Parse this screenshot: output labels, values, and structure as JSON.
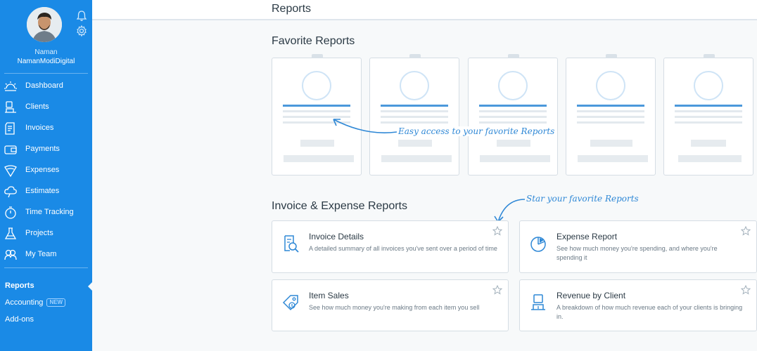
{
  "sidebar": {
    "user_name": "Naman",
    "user_company": "NamanModiDigital",
    "items": [
      {
        "label": "Dashboard",
        "icon": "sun-icon"
      },
      {
        "label": "Clients",
        "icon": "clients-icon"
      },
      {
        "label": "Invoices",
        "icon": "invoices-icon"
      },
      {
        "label": "Payments",
        "icon": "wallet-icon"
      },
      {
        "label": "Expenses",
        "icon": "expenses-icon"
      },
      {
        "label": "Estimates",
        "icon": "estimates-icon"
      },
      {
        "label": "Time Tracking",
        "icon": "stopwatch-icon"
      },
      {
        "label": "Projects",
        "icon": "flask-icon"
      },
      {
        "label": "My Team",
        "icon": "team-icon"
      }
    ],
    "reports_label": "Reports",
    "accounting_label": "Accounting",
    "accounting_badge": "NEW",
    "addons_label": "Add-ons",
    "accent_color": "#1a8ae6"
  },
  "header": {
    "title": "Reports"
  },
  "favorites": {
    "title": "Favorite Reports",
    "annotation": "Easy access to your favorite Reports"
  },
  "reports_section": {
    "title": "Invoice & Expense Reports",
    "annotation": "Star your favorite Reports",
    "cards": [
      {
        "title": "Invoice Details",
        "description": "A detailed summary of all invoices you've sent over a period of time",
        "icon": "invoice-search-icon"
      },
      {
        "title": "Expense Report",
        "description": "See how much money you're spending, and where you're spending it",
        "icon": "pie-chart-icon"
      },
      {
        "title": "Item Sales",
        "description": "See how much money you're making from each item you sell",
        "icon": "price-tag-icon"
      },
      {
        "title": "Revenue by Client",
        "description": "A breakdown of how much revenue each of your clients is bringing in.",
        "icon": "client-revenue-icon"
      }
    ]
  }
}
